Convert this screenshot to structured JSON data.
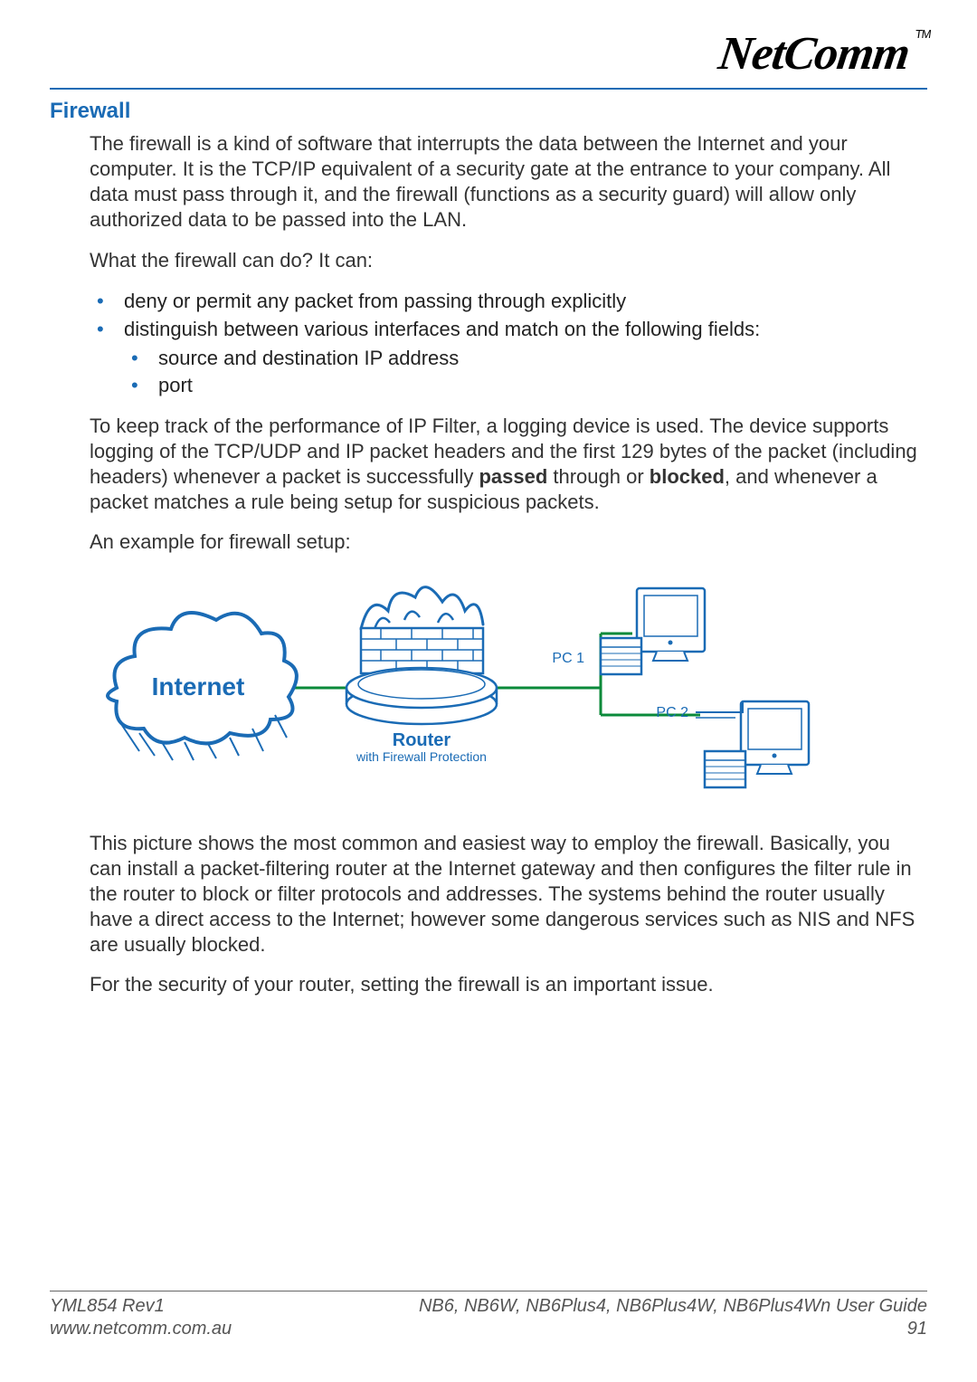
{
  "brand": {
    "name": "NetComm",
    "trademark": "TM"
  },
  "section": {
    "title": "Firewall"
  },
  "paragraphs": {
    "intro": "The firewall is a kind of software that interrupts the data between the Internet and your computer. It is the TCP/IP equivalent of a security gate at the entrance to your company. All data must pass through it, and the firewall (functions as a security guard) will allow only authorized data to be passed into the LAN.",
    "whatcan": "What the firewall can do? It can:",
    "logging1": "To keep track of the performance of IP Filter, a logging device is used. The device supports logging of the TCP/UDP and IP packet headers and the first 129 bytes of the packet (including headers) whenever a packet is successfully ",
    "logging_passed": "passed",
    "logging2": " through or ",
    "logging_blocked": "blocked",
    "logging3": ", and whenever a packet matches a rule being setup for suspicious packets.",
    "example": "An example for firewall setup:",
    "pic": "This picture shows the most common and easiest way to employ the firewall. Basically, you can install a packet-filtering router at the Internet gateway and then configures the filter rule in the router to block or filter protocols and addresses. The systems behind the router usually have a direct access to the Internet; however some dangerous services such as NIS and NFS are usually blocked.",
    "security": "For the security of your router, setting the firewall is an important issue."
  },
  "bullets": {
    "b1": "deny or permit any packet from passing through explicitly",
    "b2": "distinguish between various interfaces and match on the following fields:",
    "b2a": "source and destination IP address",
    "b2b": "port"
  },
  "diagram": {
    "internet": "Internet",
    "router": "Router",
    "router_sub": "with Firewall Protection",
    "pc1": "PC 1",
    "pc2": "PC 2"
  },
  "footer": {
    "rev": "YML854 Rev1",
    "url": "www.netcomm.com.au",
    "guide": "NB6, NB6W, NB6Plus4, NB6Plus4W, NB6Plus4Wn User Guide",
    "page": "91"
  }
}
